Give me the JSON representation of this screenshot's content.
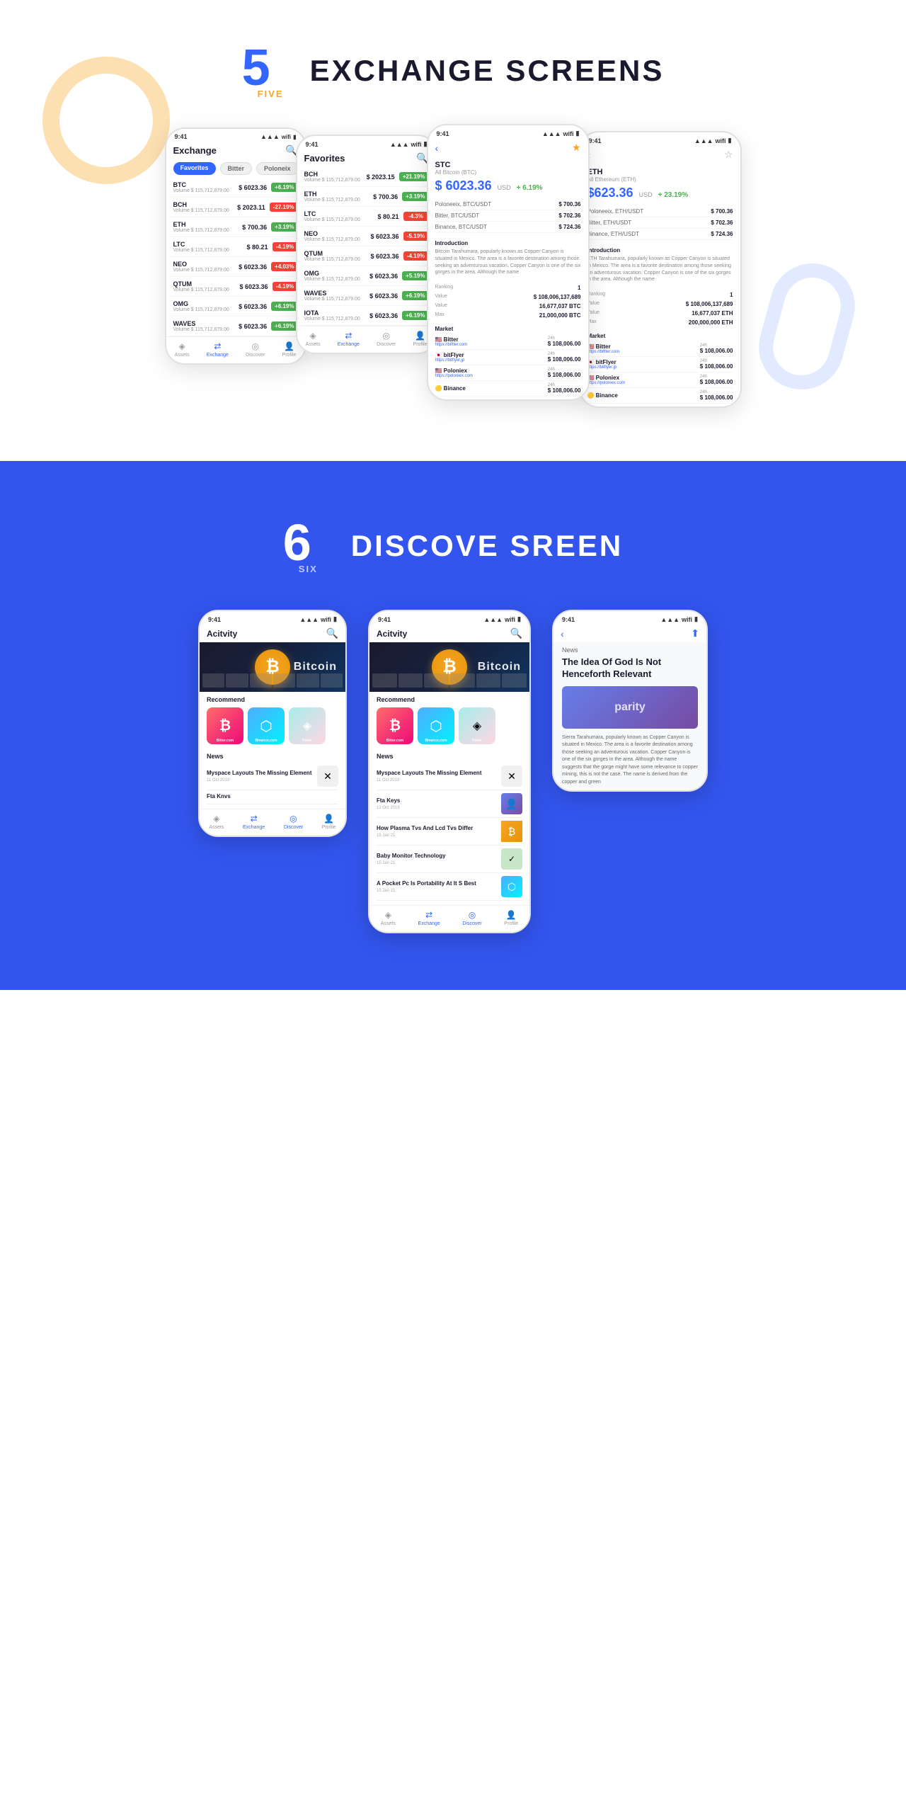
{
  "section1": {
    "number": "5",
    "word": "FIVE",
    "title": "EXCHANGE SCREENS",
    "exchange_phone": {
      "title": "Exchange",
      "tabs": [
        "Favorites",
        "Bitter",
        "Poloneix"
      ],
      "coins": [
        {
          "symbol": "BTC",
          "volume": "Volume $ 115,712,879.00",
          "price": "$ 6023.36",
          "change": "+6.19%",
          "up": true
        },
        {
          "symbol": "BCH",
          "volume": "Volume $ 115,712,879.00",
          "price": "$ 2023.11",
          "change": "-27.19%",
          "up": false
        },
        {
          "symbol": "ETH",
          "volume": "Volume $ 115,712,879.00",
          "price": "$ 700.36",
          "change": "+3.19%",
          "up": true
        },
        {
          "symbol": "LTC",
          "volume": "Volume $ 115,712,879.00",
          "price": "$ 80.21",
          "change": "-4.19%",
          "up": false
        },
        {
          "symbol": "NEO",
          "volume": "Volume $ 115,712,879.00",
          "price": "$ 6023.36",
          "change": "+4.03%",
          "up": false
        },
        {
          "symbol": "QTUM",
          "volume": "Volume $ 115,712,879.00",
          "price": "$ 6023.36",
          "change": "-4.19%",
          "up": false
        },
        {
          "symbol": "OMG",
          "volume": "Volume $ 115,712,879.00",
          "price": "$ 6023.36",
          "change": "+6.19%",
          "up": true
        },
        {
          "symbol": "WAVES",
          "volume": "Volume $ 115,712,879.00",
          "price": "$ 6023.36",
          "change": "+6.19%",
          "up": true
        }
      ],
      "nav": [
        "Assets",
        "Exchange",
        "Discover",
        "Profile"
      ]
    },
    "favorites_phone": {
      "title": "Favorites",
      "coins": [
        {
          "symbol": "BCH",
          "volume": "Volume $ 115,712,879.00",
          "price": "$ 2023.15",
          "change": "+21.19%",
          "up": true
        },
        {
          "symbol": "ETH",
          "volume": "Volume $ 115,712,879.00",
          "price": "$ 700.36",
          "change": "+3.19%",
          "up": true
        },
        {
          "symbol": "LTC",
          "volume": "Volume $ 115,712,879.00",
          "price": "$ 80.21",
          "change": "-4.3%",
          "up": false
        },
        {
          "symbol": "NEO",
          "volume": "Volume $ 115,712,879.00",
          "price": "$ 6023.36",
          "change": "-5.19%",
          "up": false
        },
        {
          "symbol": "QTUM",
          "volume": "Volume $ 115,712,879.00",
          "price": "$ 6023.36",
          "change": "-4.19%",
          "up": false
        },
        {
          "symbol": "OMG",
          "volume": "Volume $ 115,712,879.00",
          "price": "$ 6023.36",
          "change": "+5.19%",
          "up": true
        },
        {
          "symbol": "WAVES",
          "volume": "Volume $ 115,712,879.00",
          "price": "$ 6023.36",
          "change": "+6.19%",
          "up": true
        },
        {
          "symbol": "IOTA",
          "volume": "Volume $ 115,712,879.00",
          "price": "$ 6023.36",
          "change": "+6.19%",
          "up": true
        }
      ]
    },
    "btc_detail": {
      "back": "←",
      "symbol": "STC",
      "name": "All Bitcoin (BTC)",
      "price": "$ 6023.36",
      "currency": "USD",
      "change": "+ 6.19%",
      "exchanges": [
        {
          "name": "Poloneeix, BTC/USDT",
          "price": "$ 700.36"
        },
        {
          "name": "Bitter, BTC/USDT",
          "price": "$ 702.36"
        },
        {
          "name": "Binance, BTC/USDT",
          "price": "$ 724.36"
        }
      ],
      "intro_title": "Introduction",
      "intro_text": "Bitcoin Tarahumara, popularly known as Copper Canyon is situated in Mexico. The area is a favorite destination among those seeking an adventurous vacation. Copper Canyon is one of the six gorges in the area. Although the name",
      "ranking": "1",
      "vol": "$ 108,006,137,689",
      "circulating": "16,677,037 BTC",
      "max": "21,000,000 BTC",
      "market_title": "Market",
      "markets": [
        {
          "name": "Bitter",
          "url": "https://biftter.com",
          "price": "$ 108,006.00"
        },
        {
          "name": "bitFlyer",
          "url": "https://bitflyer.jp",
          "price": "$ 108,006.00"
        },
        {
          "name": "Poloniex",
          "url": "https://poloniex.com",
          "price": "$ 108,006.00"
        },
        {
          "name": "Binance",
          "url": "",
          "price": "$ 108,006.00"
        }
      ]
    },
    "eth_detail": {
      "symbol": "ETH",
      "name": "All Ethereum (ETH)",
      "price": "$623.36",
      "currency": "USD",
      "change": "+ 23.19%",
      "exchanges": [
        {
          "name": "Poloneeix, ETH/USDT",
          "price": "$ 700.36"
        },
        {
          "name": "Bitter, ETH/USDT",
          "price": "$ 702.36"
        },
        {
          "name": "Binance, ETH/USDT",
          "price": "$ 724.36"
        }
      ],
      "intro_text": "ETH Tarahumara, popularly known as Copper Canyon is situated in Mexico. The area is a favorite destination among those seeking an adventurous vacation. Copper Canyon is one of the six gorges in the area. Although the name",
      "markets": [
        {
          "name": "Bitter",
          "url": "https://biftter.com",
          "price": "$ 108,006.00"
        },
        {
          "name": "bitFlyer",
          "url": "https://bitflyer.jp",
          "price": "$ 108,006.00"
        },
        {
          "name": "Poloniex",
          "url": "https://poloniex.com",
          "price": "$ 108,006.00"
        },
        {
          "name": "Binance",
          "url": "",
          "price": "$ 108,006.00"
        }
      ]
    }
  },
  "section2": {
    "number": "6",
    "word": "SIX",
    "title": "DISCOVE SREEN",
    "activity_phone1": {
      "title": "Acitvity",
      "bitcoin_label": "Bitcoin",
      "recommend_label": "Recommend",
      "cards": [
        {
          "label": "Bitter.com",
          "type": "red"
        },
        {
          "label": "Binance.com",
          "type": "blue"
        },
        {
          "label": "Polox",
          "type": "light"
        }
      ],
      "news_label": "News",
      "news": [
        {
          "title": "Myspace Layouts The Missing Element",
          "date": "11 Oct 2019"
        },
        {
          "title": "Fta Knvs",
          "date": ""
        }
      ]
    },
    "activity_phone2": {
      "title": "Acitvity",
      "bitcoin_label": "Bitcoin",
      "recommend_label": "Recommend",
      "news_label": "News",
      "news": [
        {
          "title": "Myspace Layouts The Missing Element",
          "date": "11 Oct 2019"
        },
        {
          "title": "Fta Keys",
          "date": "12 Oct 2019"
        },
        {
          "title": "How Plasma Tvs And Lcd Tvs Differ",
          "date": "15 Jan 21"
        },
        {
          "title": "Baby Monitor Technology",
          "date": "15 Jan 21"
        },
        {
          "title": "A Pocket Pc Is Portability At It S Best",
          "date": "15 Jan 21"
        }
      ]
    },
    "article_phone": {
      "news_label": "News",
      "article_title": "The Idea Of God Is Not Henceforth Relevant",
      "article_body": "Sierra Tarahumara, popularly known as Copper Canyon is situated in Mexico. The area is a favorite destination among those seeking an adventurous vacation. Copper Canyon is one of the six gorges in the area. Although the name suggests that the gorge might have some relevance to copper mining, this is not the case. The name is derived from the copper and green"
    }
  }
}
